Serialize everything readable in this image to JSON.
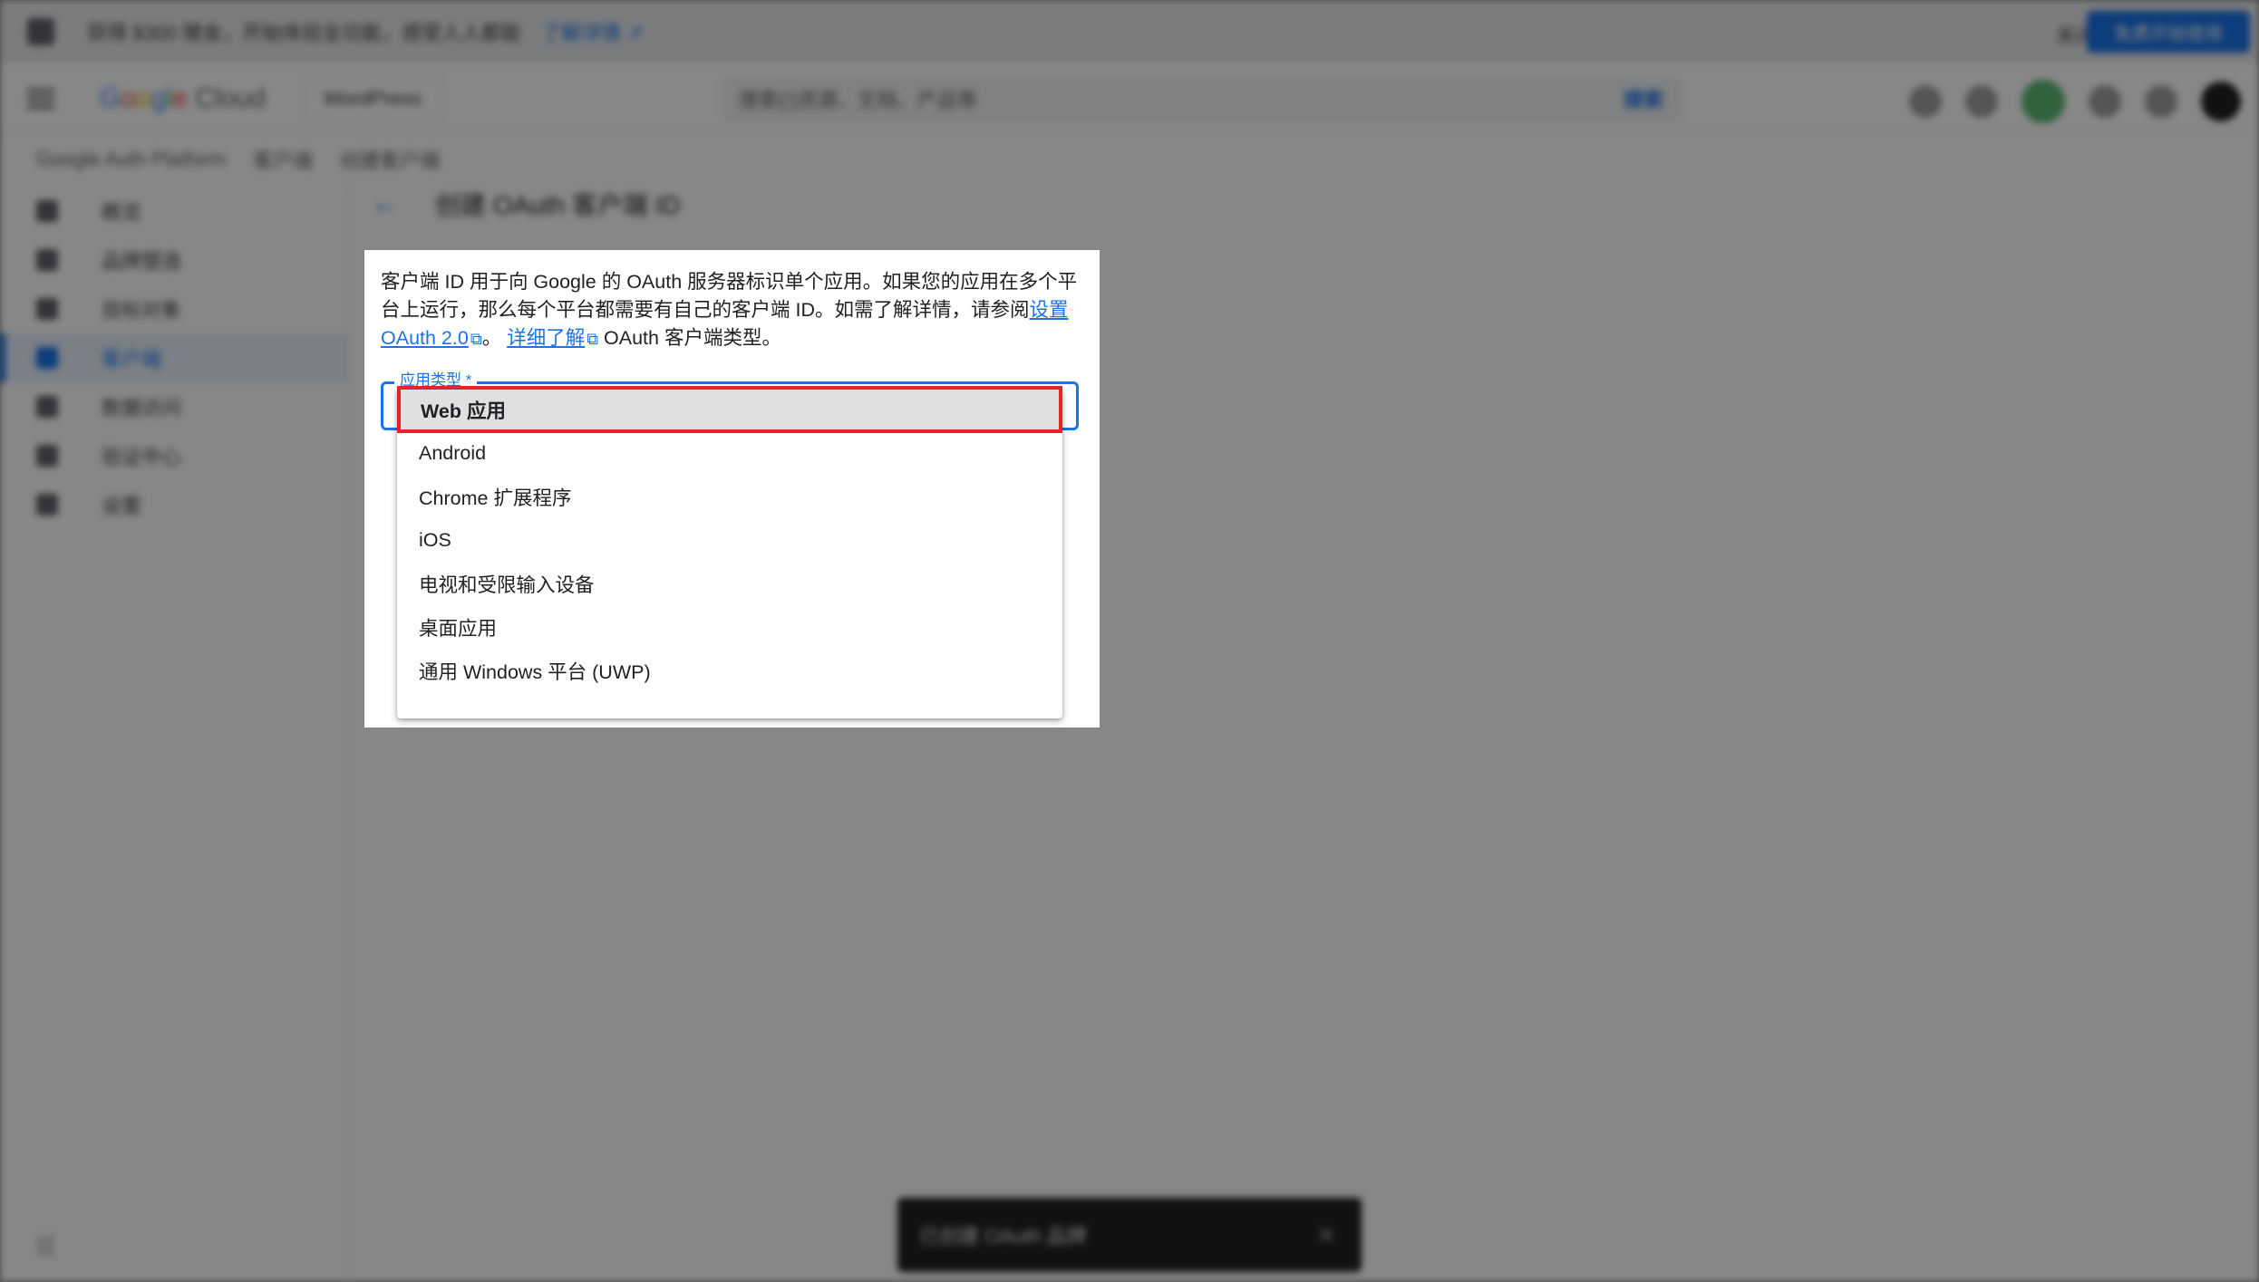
{
  "banner": {
    "text": "获得 $300 赠金，开始体验全功能，感受人人都能",
    "link": "了解详情 ↗",
    "dismiss": "关闭",
    "cta": "免费开始使用"
  },
  "topbar": {
    "logo_parts": [
      "G",
      "o",
      "o",
      "g",
      "l",
      "e",
      " Cloud"
    ],
    "project": "WordPress",
    "search_placeholder": "搜索(/)资源、文档、产品等",
    "search_button": "搜索"
  },
  "breadcrumb": [
    "Google Auth Platform",
    "客户端",
    "创建客户端"
  ],
  "sidebar": {
    "items": [
      {
        "label": "概览",
        "active": false
      },
      {
        "label": "品牌塑造",
        "active": false
      },
      {
        "label": "目标对象",
        "active": false
      },
      {
        "label": "客户端",
        "active": true
      },
      {
        "label": "数据访问",
        "active": false
      },
      {
        "label": "验证中心",
        "active": false
      },
      {
        "label": "设置",
        "active": false
      }
    ]
  },
  "page_header": {
    "back_icon": "arrow-back-icon",
    "title": "创建 OAuth 客户端 ID"
  },
  "dialog": {
    "desc_part1": "客户端 ID 用于向 Google 的 OAuth 服务器标识单个应用。如果您的应用在多个平台上运行，那么每个平台都需要有自己的客户端 ID。如需了解详情，请参阅",
    "desc_link1": "设置 OAuth 2.0",
    "desc_sep": "。",
    "desc_link2": "详细了解",
    "desc_part2": " OAuth 客户端类型。",
    "field_label": "应用类型 *",
    "options": [
      "Web 应用",
      "Android",
      "Chrome 扩展程序",
      "iOS",
      "电视和受限输入设备",
      "桌面应用",
      "通用 Windows 平台 (UWP)"
    ],
    "selected_index": 0
  },
  "snackbar": {
    "text": "已创建 OAuth 品牌",
    "close_icon": "close-icon"
  },
  "colors": {
    "accent": "#1a73e8",
    "highlight_border": "#e5232c",
    "scrim": "#808080"
  }
}
